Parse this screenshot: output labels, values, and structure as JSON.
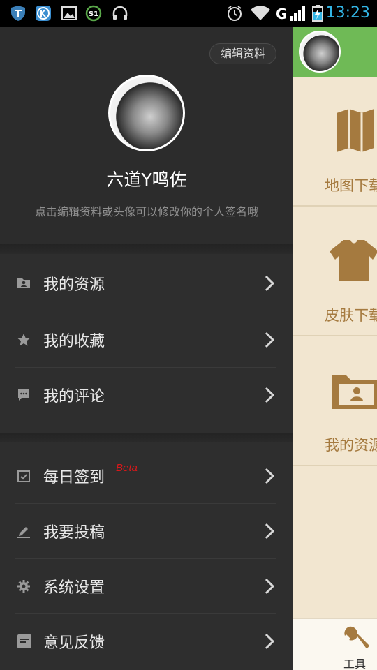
{
  "status_bar": {
    "time": "13:23",
    "network": "G",
    "icons": [
      "shield-icon",
      "k-app-icon",
      "image-icon",
      "s1-icon",
      "headphones-icon",
      "alarm-icon",
      "wifi-icon",
      "signal-icon",
      "battery-charging-icon"
    ]
  },
  "profile": {
    "edit_label": "编辑资料",
    "username": "六道Y鸣佐",
    "signature": "点击编辑资料或头像可以修改你的个人签名哦"
  },
  "menu_group_1": [
    {
      "label": "我的资源",
      "icon": "resource-folder-icon"
    },
    {
      "label": "我的收藏",
      "icon": "star-icon"
    },
    {
      "label": "我的评论",
      "icon": "comment-icon"
    }
  ],
  "menu_group_2": [
    {
      "label": "每日签到",
      "icon": "calendar-check-icon",
      "badge": "Beta"
    },
    {
      "label": "我要投稿",
      "icon": "pencil-icon"
    },
    {
      "label": "系统设置",
      "icon": "gear-icon"
    },
    {
      "label": "意见反馈",
      "icon": "feedback-icon"
    }
  ],
  "right_panel": {
    "tiles": [
      {
        "label": "地图下载",
        "icon": "map-icon"
      },
      {
        "label": "皮肤下载",
        "icon": "shirt-icon"
      },
      {
        "label": "我的资源",
        "icon": "profile-folder-icon"
      }
    ],
    "bottom_tab": {
      "label": "工具",
      "icon": "wrench-icon"
    }
  },
  "colors": {
    "drawer_bg": "#2b2b2b",
    "panel_bg": "#f2e6d0",
    "header_green": "#6fba56",
    "accent_brown": "#a57a3f",
    "beta_red": "#d8181a",
    "time_blue": "#33b5e5"
  }
}
